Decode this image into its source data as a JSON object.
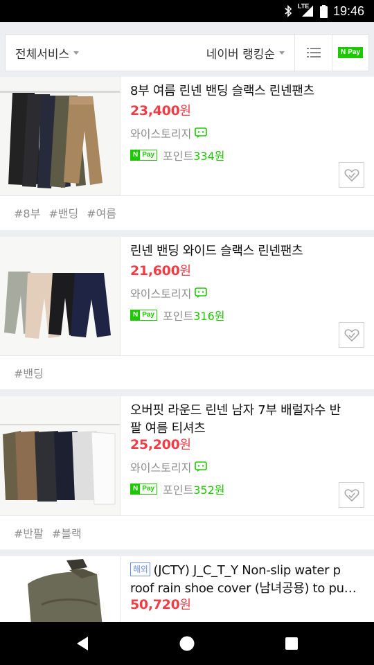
{
  "status": {
    "time": "19:46",
    "network": "LTE"
  },
  "filter": {
    "service_label": "전체서비스",
    "sort_label": "네이버 랭킹순",
    "npay_n": "N",
    "npay_pay": "Pay"
  },
  "npay_badge": {
    "n": "N",
    "pay": "Pay"
  },
  "products": [
    {
      "title": "8부 여름 린넨 밴딩 슬랙스 린넨팬츠",
      "price": "23,400",
      "currency": "원",
      "seller": "와이스토리지",
      "points_label": "포인트",
      "points_amount": "334원",
      "tags": [
        "#8부",
        "#밴딩",
        "#여름"
      ]
    },
    {
      "title": "린넨 밴딩 와이드 슬랙스 린넨팬츠",
      "price": "21,600",
      "currency": "원",
      "seller": "와이스토리지",
      "points_label": "포인트",
      "points_amount": "316원",
      "tags": [
        "#밴딩"
      ]
    },
    {
      "title_line1": "오버핏 라운드 린넨 남자 7부 배럴자수 반",
      "title_line2": "팔 여름 티셔츠",
      "price": "25,200",
      "currency": "원",
      "seller": "와이스토리지",
      "points_label": "포인트",
      "points_amount": "352원",
      "tags": [
        "#반팔",
        "#블랙"
      ]
    },
    {
      "badge": "해외",
      "title_line1": "(JCTY) J_C_T_Y Non-slip water p",
      "title_line2": "roof rain shoe cover (남녀공용) to pu…",
      "price": "50,720",
      "currency": "원"
    }
  ]
}
